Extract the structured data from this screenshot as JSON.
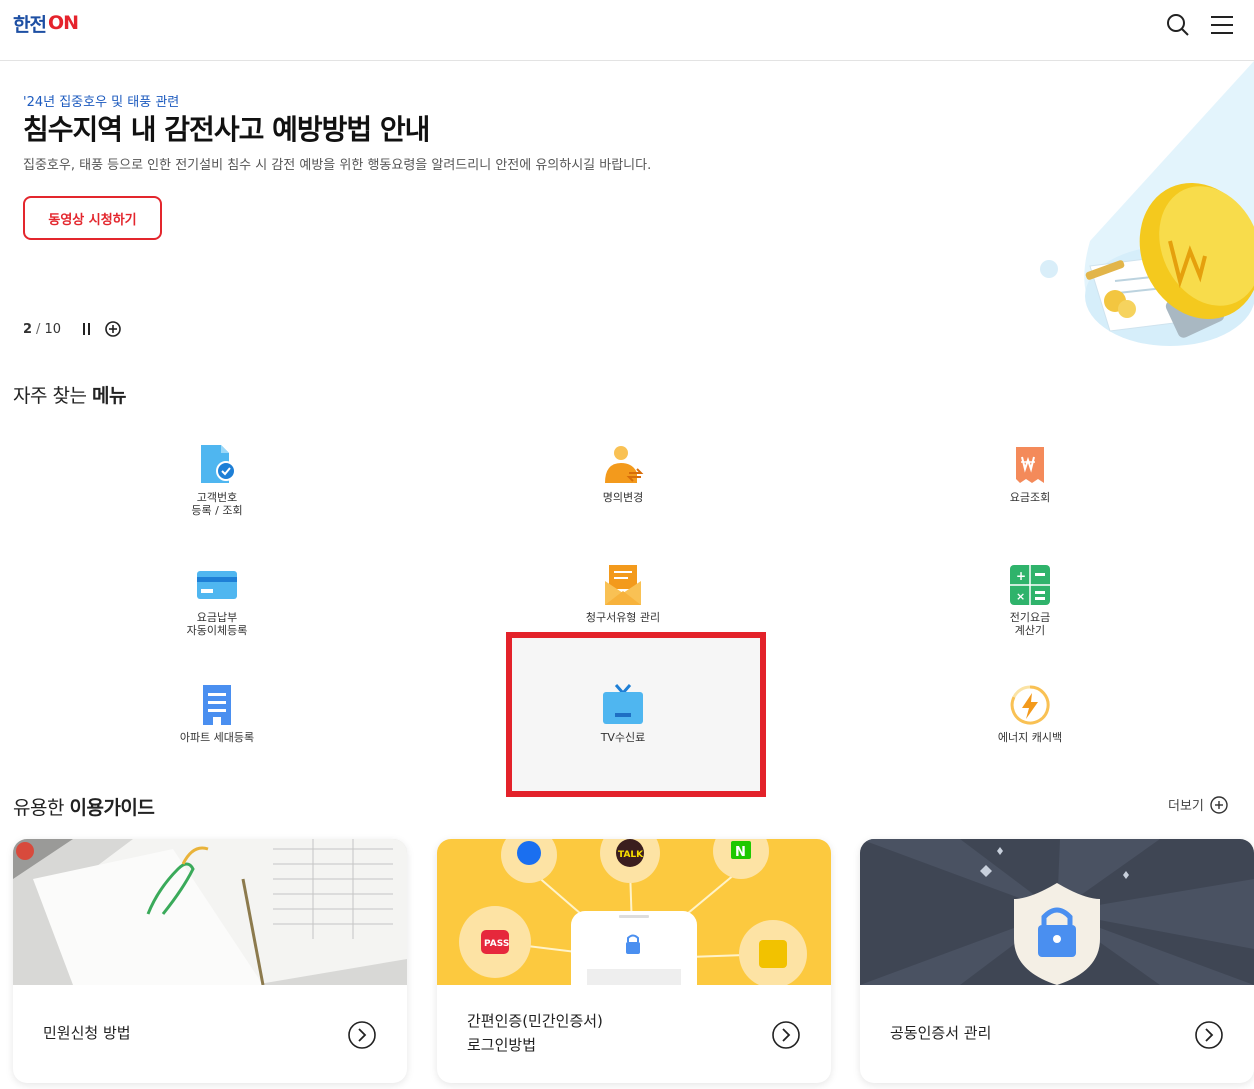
{
  "header": {
    "logo_text": "한전",
    "logo_on": "ON"
  },
  "hero": {
    "subtitle": "'24년 집중호우 및 태풍 관련",
    "title": "침수지역 내 감전사고 예방방법 안내",
    "description": "집중호우, 태풍 등으로 인한 전기설비 침수 시 감전 예방을 위한 행동요령을 알려드리니 안전에 유의하시길 바랍니다.",
    "button_label": "동영상 시청하기",
    "pager_current": "2",
    "pager_total": "10"
  },
  "frequent_menu": {
    "title_plain": "자주 찾는 ",
    "title_bold": "메뉴",
    "items": [
      {
        "line1": "고객번호",
        "line2": "등록 / 조회",
        "icon": "document-check-icon"
      },
      {
        "line1": "명의변경",
        "line2": "",
        "icon": "person-change-icon"
      },
      {
        "line1": "요금조회",
        "line2": "",
        "icon": "won-receipt-icon"
      },
      {
        "line1": "요금납부",
        "line2": "자동이체등록",
        "icon": "credit-card-icon"
      },
      {
        "line1": "청구서유형 관리",
        "line2": "",
        "icon": "envelope-icon"
      },
      {
        "line1": "전기요금",
        "line2": "계산기",
        "icon": "calculator-icon"
      },
      {
        "line1": "아파트 세대등록",
        "line2": "",
        "icon": "apartment-icon"
      },
      {
        "line1": "TV수신료",
        "line2": "",
        "icon": "tv-icon"
      },
      {
        "line1": "에너지 캐시백",
        "line2": "",
        "icon": "energy-cashback-icon"
      }
    ]
  },
  "guide": {
    "title_plain": "유용한 ",
    "title_bold": "이용가이드",
    "more_label": "더보기",
    "cards": [
      {
        "line1": "민원신청 방법",
        "line2": ""
      },
      {
        "line1": "간편인증(민간인증서)",
        "line2": "로그인방법"
      },
      {
        "line1": "공동인증서 관리",
        "line2": ""
      }
    ],
    "card2_badges": {
      "talk": "TALK",
      "naver": "N",
      "pass": "PASS"
    }
  },
  "colors": {
    "brand_blue": "#1d4fa3",
    "brand_red": "#e3262d",
    "icon_blue": "#4fb6f0",
    "highlight": "#e3222a"
  }
}
